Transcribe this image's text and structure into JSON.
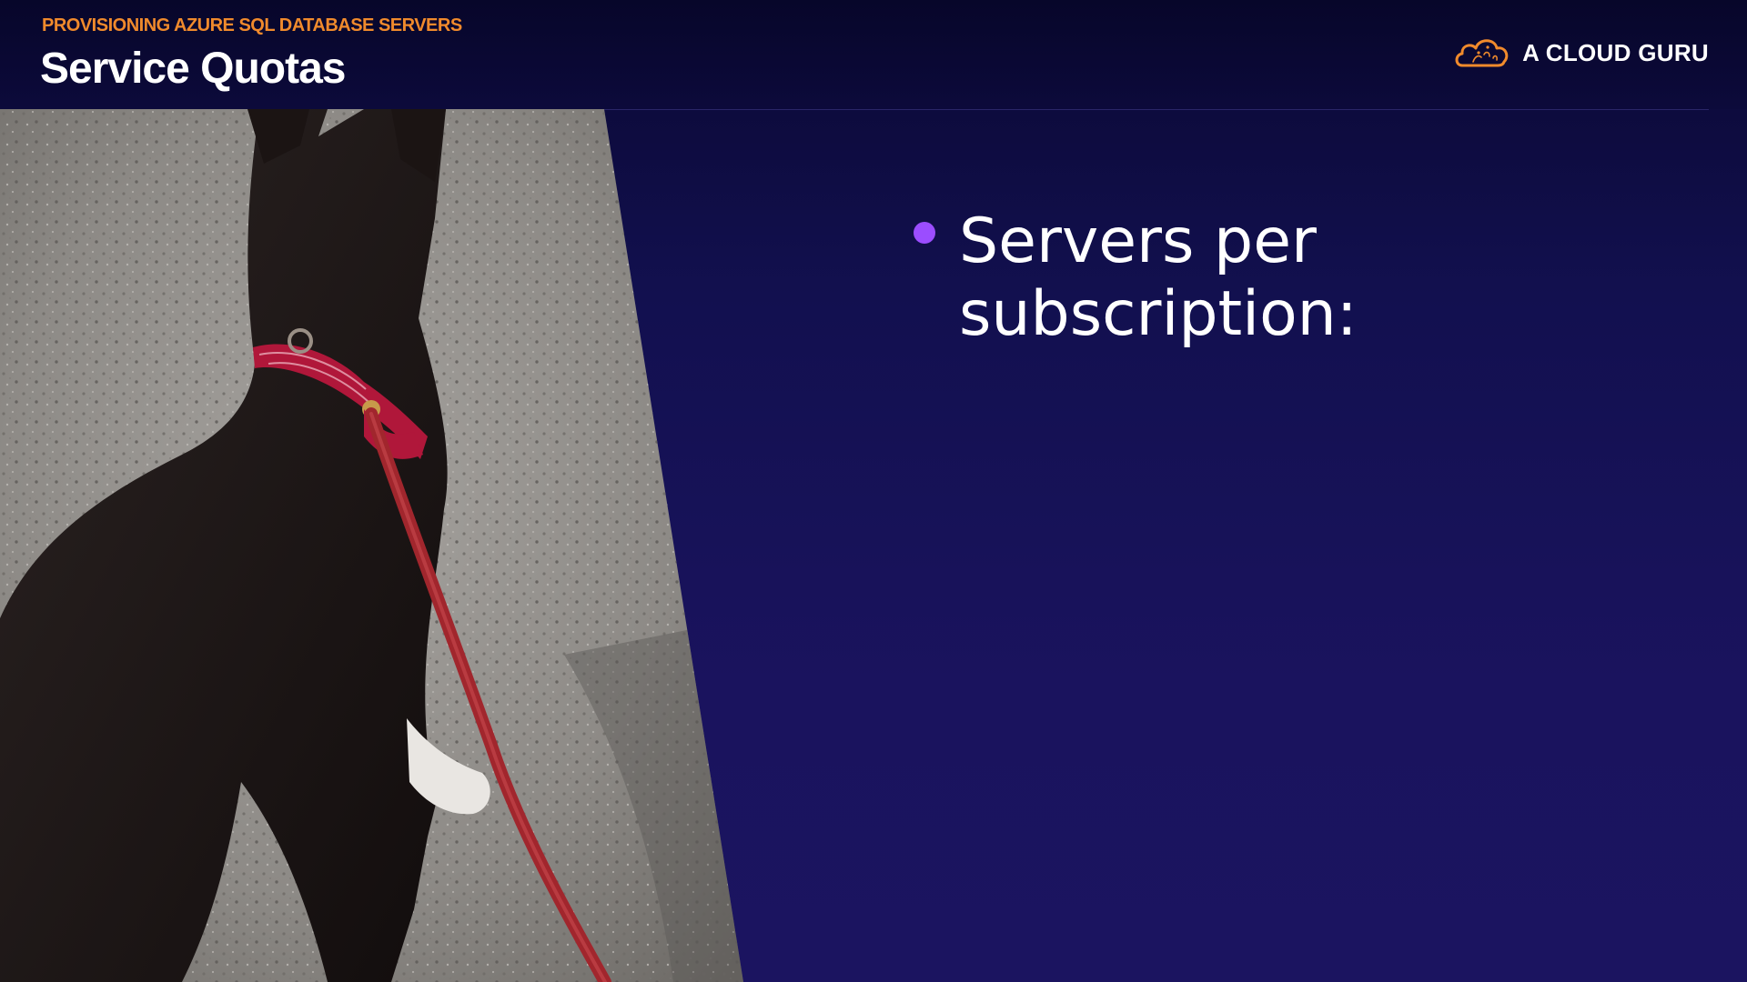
{
  "header": {
    "eyebrow": "PROVISIONING AZURE SQL DATABASE SERVERS",
    "title": "Service Quotas"
  },
  "brand": {
    "logo_text": "A CLOUD GURU",
    "logo_icon": "cloud-logo-icon",
    "accent_color": "#f08a2c"
  },
  "photo": {
    "subject": "dog-on-leash-photo"
  },
  "bullets": [
    {
      "text": "Servers per subscription:",
      "icon": "bullet-dot",
      "color": "#9b4dff"
    }
  ],
  "colors": {
    "background": "#1a135e",
    "header_background": "#0a0833",
    "text": "#ffffff",
    "bullet": "#9b4dff"
  }
}
